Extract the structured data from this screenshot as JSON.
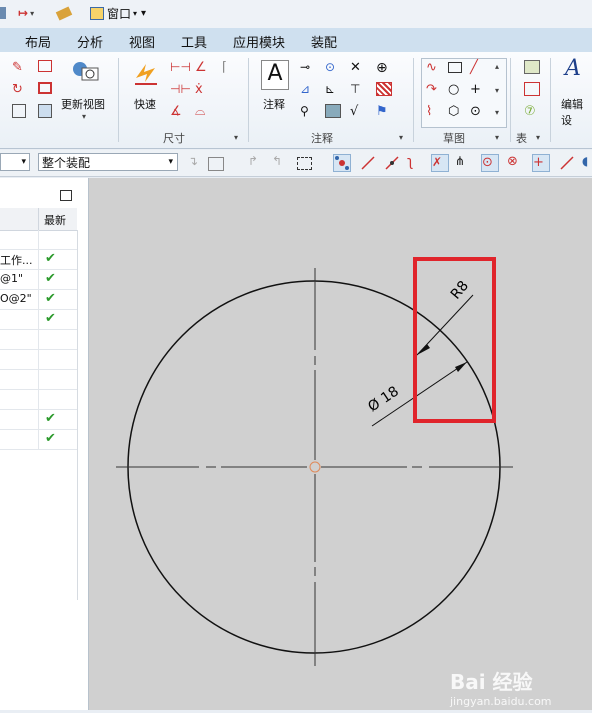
{
  "quickbar": {
    "window_menu": "窗口"
  },
  "tabs": [
    "布局",
    "分析",
    "视图",
    "工具",
    "应用模块",
    "装配"
  ],
  "ribbon": {
    "update_view": "更新视图",
    "quick": "快速",
    "annotate": "注释",
    "edit_settings": "编辑设",
    "groups": {
      "dimension": "尺寸",
      "annotation": "注释",
      "sketch": "草图",
      "table": "表"
    }
  },
  "toolbar": {
    "assembly_filter": "整个装配"
  },
  "nav": {
    "column_latest": "最新",
    "rows": [
      {
        "text": "",
        "ok": false
      },
      {
        "text": "工作...",
        "ok": true
      },
      {
        "text": "@1\"",
        "ok": true
      },
      {
        "text": "O@2\"",
        "ok": true
      },
      {
        "text": "",
        "ok": true
      },
      {
        "text": "",
        "ok": false
      },
      {
        "text": "",
        "ok": false
      },
      {
        "text": "",
        "ok": false
      },
      {
        "text": "",
        "ok": false
      },
      {
        "text": "",
        "ok": true
      },
      {
        "text": "",
        "ok": true
      }
    ]
  },
  "drawing": {
    "dim_radius": "R8",
    "dim_diameter": "Ø 18",
    "highlight_color": "#e0242b"
  },
  "watermark": {
    "brand": "Bai 经验",
    "url": "jingyan.baidu.com"
  }
}
